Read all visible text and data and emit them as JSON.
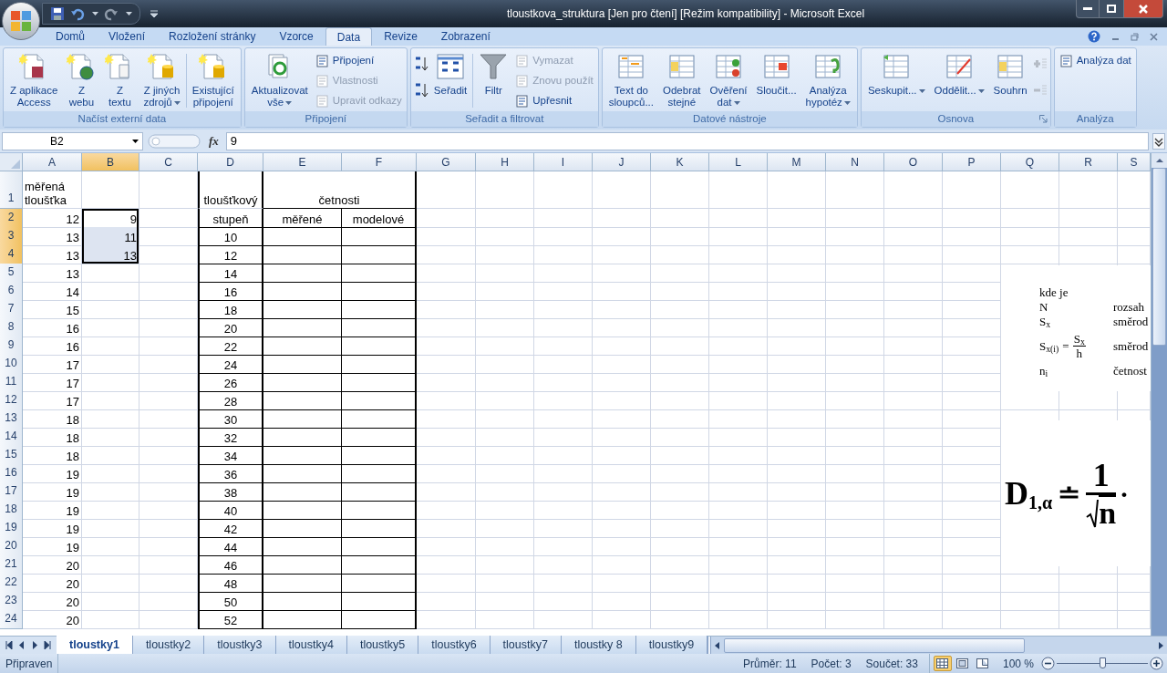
{
  "window": {
    "title": "tloustkova_struktura  [Jen pro čtení]  [Režim kompatibility] - Microsoft Excel"
  },
  "ribbon_tabs": [
    {
      "label": "Domů",
      "selected": false
    },
    {
      "label": "Vložení",
      "selected": false
    },
    {
      "label": "Rozložení stránky",
      "selected": false
    },
    {
      "label": "Vzorce",
      "selected": false
    },
    {
      "label": "Data",
      "selected": true
    },
    {
      "label": "Revize",
      "selected": false
    },
    {
      "label": "Zobrazení",
      "selected": false
    }
  ],
  "ribbon_groups": [
    {
      "title": "Načíst externí data",
      "dialog_launcher": false,
      "items": [
        {
          "kind": "large",
          "lines": [
            "Z aplikace",
            "Access"
          ],
          "dropdown": false,
          "disabled": false
        },
        {
          "kind": "large",
          "lines": [
            "Z",
            "webu"
          ],
          "dropdown": false,
          "disabled": false
        },
        {
          "kind": "large",
          "lines": [
            "Z",
            "textu"
          ],
          "dropdown": false,
          "disabled": false
        },
        {
          "kind": "large",
          "lines": [
            "Z jiných",
            "zdrojů"
          ],
          "dropdown": true,
          "disabled": false
        },
        {
          "kind": "separator"
        },
        {
          "kind": "large",
          "lines": [
            "Existující",
            "připojení"
          ],
          "dropdown": false,
          "disabled": false
        }
      ]
    },
    {
      "title": "Připojení",
      "dialog_launcher": false,
      "items": [
        {
          "kind": "large",
          "lines": [
            "Aktualizovat",
            "vše"
          ],
          "dropdown": true,
          "disabled": false
        },
        {
          "kind": "small",
          "lines": [
            "Připojení"
          ],
          "dropdown": false,
          "disabled": false
        },
        {
          "kind": "small",
          "lines": [
            "Vlastnosti"
          ],
          "dropdown": false,
          "disabled": true
        },
        {
          "kind": "small",
          "lines": [
            "Upravit odkazy"
          ],
          "dropdown": false,
          "disabled": true
        }
      ]
    },
    {
      "title": "Seřadit a filtrovat",
      "dialog_launcher": false,
      "items": [
        {
          "kind": "icon",
          "disabled": false
        },
        {
          "kind": "icon",
          "disabled": false
        },
        {
          "kind": "large",
          "lines": [
            "Seřadit"
          ],
          "dropdown": false,
          "disabled": false
        },
        {
          "kind": "separator"
        },
        {
          "kind": "large",
          "lines": [
            "Filtr"
          ],
          "dropdown": false,
          "disabled": false
        },
        {
          "kind": "small",
          "lines": [
            "Vymazat"
          ],
          "dropdown": false,
          "disabled": true
        },
        {
          "kind": "small",
          "lines": [
            "Znovu použít"
          ],
          "dropdown": false,
          "disabled": true
        },
        {
          "kind": "small",
          "lines": [
            "Upřesnit"
          ],
          "dropdown": false,
          "disabled": false
        }
      ]
    },
    {
      "title": "Datové nástroje",
      "dialog_launcher": false,
      "items": [
        {
          "kind": "large",
          "lines": [
            "Text do",
            "sloupců..."
          ],
          "dropdown": false,
          "disabled": false
        },
        {
          "kind": "large",
          "lines": [
            "Odebrat",
            "stejné"
          ],
          "dropdown": false,
          "disabled": false
        },
        {
          "kind": "large",
          "lines": [
            "Ověření",
            "dat"
          ],
          "dropdown": true,
          "disabled": false
        },
        {
          "kind": "large",
          "lines": [
            "Sloučit..."
          ],
          "dropdown": false,
          "disabled": false
        },
        {
          "kind": "large",
          "lines": [
            "Analýza",
            "hypotéz"
          ],
          "dropdown": true,
          "disabled": false
        }
      ]
    },
    {
      "title": "Osnova",
      "dialog_launcher": true,
      "items": [
        {
          "kind": "large",
          "lines": [
            "Seskupit..."
          ],
          "dropdown": true,
          "disabled": false
        },
        {
          "kind": "large",
          "lines": [
            "Oddělit..."
          ],
          "dropdown": true,
          "disabled": false
        },
        {
          "kind": "large",
          "lines": [
            "Souhrn"
          ],
          "dropdown": false,
          "disabled": false
        },
        {
          "kind": "icon",
          "disabled": true
        },
        {
          "kind": "icon",
          "disabled": true
        }
      ]
    },
    {
      "title": "Analýza",
      "dialog_launcher": false,
      "items": [
        {
          "kind": "small",
          "lines": [
            "Analýza dat"
          ],
          "dropdown": false,
          "disabled": false
        }
      ]
    }
  ],
  "formula_bar": {
    "name_box": "B2",
    "fx_label": "fx",
    "value": "9"
  },
  "sheet": {
    "columns": [
      {
        "label": "A",
        "selected": false
      },
      {
        "label": "B",
        "selected": true
      },
      {
        "label": "C",
        "selected": false
      },
      {
        "label": "D",
        "selected": false
      },
      {
        "label": "E",
        "selected": false
      },
      {
        "label": "F",
        "selected": false
      },
      {
        "label": "G",
        "selected": false
      },
      {
        "label": "H",
        "selected": false
      },
      {
        "label": "I",
        "selected": false
      },
      {
        "label": "J",
        "selected": false
      },
      {
        "label": "K",
        "selected": false
      },
      {
        "label": "L",
        "selected": false
      },
      {
        "label": "M",
        "selected": false
      },
      {
        "label": "N",
        "selected": false
      },
      {
        "label": "O",
        "selected": false
      },
      {
        "label": "P",
        "selected": false
      },
      {
        "label": "Q",
        "selected": false
      },
      {
        "label": "R",
        "selected": false
      },
      {
        "label": "S",
        "selected": false
      }
    ],
    "rows": [
      {
        "label": "1",
        "selected": false,
        "cells": {
          "A": "měřená tloušťka",
          "D": "tloušťkový",
          "E": "četnosti"
        }
      },
      {
        "label": "2",
        "selected": true,
        "cells": {
          "A": "12",
          "B": "9",
          "D": "stupeň",
          "E": "měřené",
          "F": "modelové"
        }
      },
      {
        "label": "3",
        "selected": true,
        "cells": {
          "A": "13",
          "B": "11",
          "D": "10"
        }
      },
      {
        "label": "4",
        "selected": true,
        "cells": {
          "A": "13",
          "B": "13",
          "D": "12"
        }
      },
      {
        "label": "5",
        "selected": false,
        "cells": {
          "A": "13",
          "D": "14"
        }
      },
      {
        "label": "6",
        "selected": false,
        "cells": {
          "A": "14",
          "D": "16"
        }
      },
      {
        "label": "7",
        "selected": false,
        "cells": {
          "A": "15",
          "D": "18"
        }
      },
      {
        "label": "8",
        "selected": false,
        "cells": {
          "A": "16",
          "D": "20"
        }
      },
      {
        "label": "9",
        "selected": false,
        "cells": {
          "A": "16",
          "D": "22"
        }
      },
      {
        "label": "10",
        "selected": false,
        "cells": {
          "A": "17",
          "D": "24"
        }
      },
      {
        "label": "11",
        "selected": false,
        "cells": {
          "A": "17",
          "D": "26"
        }
      },
      {
        "label": "12",
        "selected": false,
        "cells": {
          "A": "17",
          "D": "28"
        }
      },
      {
        "label": "13",
        "selected": false,
        "cells": {
          "A": "18",
          "D": "30"
        }
      },
      {
        "label": "14",
        "selected": false,
        "cells": {
          "A": "18",
          "D": "32"
        }
      },
      {
        "label": "15",
        "selected": false,
        "cells": {
          "A": "18",
          "D": "34"
        }
      },
      {
        "label": "16",
        "selected": false,
        "cells": {
          "A": "19",
          "D": "36"
        }
      },
      {
        "label": "17",
        "selected": false,
        "cells": {
          "A": "19",
          "D": "38"
        }
      },
      {
        "label": "18",
        "selected": false,
        "cells": {
          "A": "19",
          "D": "40"
        }
      },
      {
        "label": "19",
        "selected": false,
        "cells": {
          "A": "19",
          "D": "42"
        }
      },
      {
        "label": "20",
        "selected": false,
        "cells": {
          "A": "19",
          "D": "44"
        }
      },
      {
        "label": "21",
        "selected": false,
        "cells": {
          "A": "20",
          "D": "46"
        }
      },
      {
        "label": "22",
        "selected": false,
        "cells": {
          "A": "20",
          "D": "48"
        }
      },
      {
        "label": "23",
        "selected": false,
        "cells": {
          "A": "20",
          "D": "50"
        }
      },
      {
        "label": "24",
        "selected": false,
        "cells": {
          "A": "20",
          "D": "52"
        }
      }
    ]
  },
  "equation_legend": {
    "heading": "kde je",
    "rows": [
      {
        "kind": "plain",
        "symbol": "N",
        "description": "rozsah"
      },
      {
        "kind": "plain",
        "symbol": "S$_{x}$",
        "description": "směrod"
      },
      {
        "kind": "fraction",
        "symbol": "S$_{x(i)}$",
        "relation": "=",
        "numerator": "S$_{x}$",
        "denominator": "h",
        "description": "směrod"
      },
      {
        "kind": "plain",
        "symbol": "n$_{i}$",
        "description": "četnost"
      }
    ]
  },
  "big_formula": {
    "lhs": "D",
    "subscript": "1,α",
    "relation": "≐",
    "numerator": "1",
    "denominator": "n",
    "operator": "·"
  },
  "sheet_tabs": [
    {
      "label": "tloustky1",
      "selected": true
    },
    {
      "label": "tloustky2",
      "selected": false
    },
    {
      "label": "tloustky3",
      "selected": false
    },
    {
      "label": "tloustky4",
      "selected": false
    },
    {
      "label": "tloustky5",
      "selected": false
    },
    {
      "label": "tloustky6",
      "selected": false
    },
    {
      "label": "tloustky7",
      "selected": false
    },
    {
      "label": "tloustky 8",
      "selected": false
    },
    {
      "label": "tloustky9",
      "selected": false
    }
  ],
  "status_bar": {
    "status": "Připraven",
    "stats": [
      "Průměr: 11",
      "Počet: 3",
      "Součet: 33"
    ],
    "views": [
      {
        "selected": true
      },
      {
        "selected": false
      },
      {
        "selected": false
      }
    ],
    "zoom": "100 %",
    "zoom_level": {
      "level": 0.5
    }
  }
}
